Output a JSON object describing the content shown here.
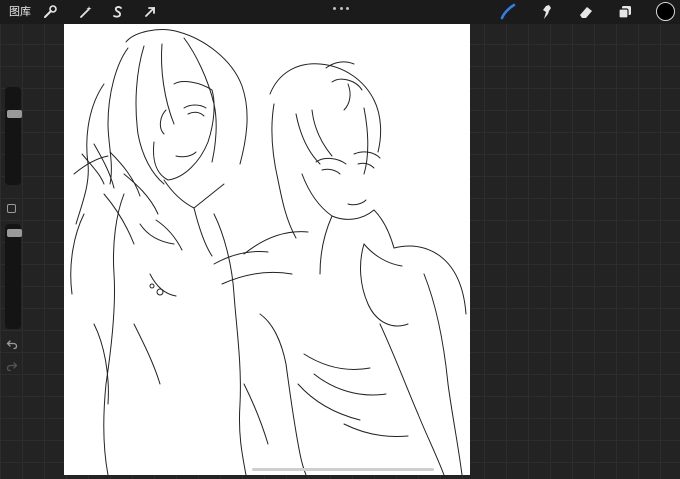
{
  "topbar": {
    "gallery_label": "图库",
    "left_tools": [
      {
        "name": "actions",
        "icon": "wrench-icon"
      },
      {
        "name": "adjustments",
        "icon": "magic-wand-icon"
      },
      {
        "name": "selection",
        "icon": "selection-s-icon"
      },
      {
        "name": "transform",
        "icon": "arrow-cursor-icon"
      }
    ],
    "right_tools": [
      {
        "name": "brush",
        "icon": "brush-icon",
        "active": true
      },
      {
        "name": "smudge",
        "icon": "smudge-icon"
      },
      {
        "name": "eraser",
        "icon": "eraser-icon"
      },
      {
        "name": "layers",
        "icon": "layers-icon"
      }
    ],
    "current_color": "#000000",
    "active_tool_color": "#2f7fe6"
  },
  "sidebar": {
    "brush_size_level": 0.25,
    "brush_opacity_level": 0.05,
    "icons": [
      "modify-square-icon",
      "undo-icon",
      "redo-icon"
    ]
  },
  "canvas": {
    "background": "#ffffff"
  }
}
